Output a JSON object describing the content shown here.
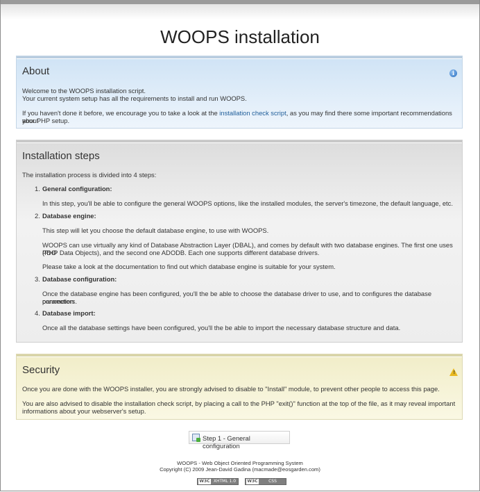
{
  "page": {
    "title": "WOOPS installation"
  },
  "about": {
    "heading": "About",
    "icon": "info-icon",
    "line1": "Welcome to the WOOPS installation script.",
    "line2": "Your current system setup has all the requirements to install and run WOOPS.",
    "para2_before": "If you haven't done it before, we encourage you to take a look at the ",
    "para2_link": "installation check script",
    "para2_after_line1": ", as you may find there some important recommendations about",
    "para2_line2": "your PHP setup."
  },
  "steps": {
    "heading": "Installation steps",
    "intro": "The installation process is divided into 4 steps:",
    "items": [
      {
        "num": "1.",
        "title": "General configuration:",
        "text": [
          "In this step, you'll be able to configure the general WOOPS options, like the installed modules, the server's timezone, the default language, etc."
        ]
      },
      {
        "num": "2.",
        "title": "Database engine:",
        "text": [
          "This step will let you choose the default database engine, to use with WOOPS.",
          "WOOPS can use virtually any kind of Database Abstraction Layer (DBAL), and comes by default with two database engines. The first one uses PDO",
          "(PHP Data Objects), and the second one ADODB. Each one supports different database drivers.",
          "Please take a look at the documentation to find out which database engine is suitable for your system."
        ]
      },
      {
        "num": "3.",
        "title": "Database configuration:",
        "text": [
          "Once the database engine has been configured, you'll the be able to choose the database driver to use, and to configures the database connection",
          "parameters."
        ]
      },
      {
        "num": "4.",
        "title": "Database import:",
        "text": [
          "Once all the database settings have been configured, you'll the be able to import the necessary database structure and data."
        ]
      }
    ]
  },
  "security": {
    "heading": "Security",
    "icon": "warning-icon",
    "para1": "Once you are done with the WOOPS installer, you are strongly advised to disable to \"Install\" module, to prevent other people to access this page.",
    "para2_line1": "You are also advised to disable the installation check script, by placing a call to the PHP \"exit()\" function at the top of the file, as it may reveal important",
    "para2_line2": "informations about your webserver's setup."
  },
  "next_button": {
    "label": "Step 1 - General configuration",
    "icon": "next-step-icon"
  },
  "footer": {
    "line1": "WOOPS - Web Object Oriented Programming System",
    "line2": "Copyright (C) 2009 Jean-David Gadina (macmade@eosgarden.com)",
    "badge1_left": "W3C",
    "badge1_right": "XHTML 1.0",
    "badge2_left": "W3C",
    "badge2_right": "CSS"
  },
  "colors": {
    "link": "#1f5d99",
    "about_bg": "#cfe3f5",
    "security_bg": "#f1edc8",
    "warning": "#e8b820"
  }
}
